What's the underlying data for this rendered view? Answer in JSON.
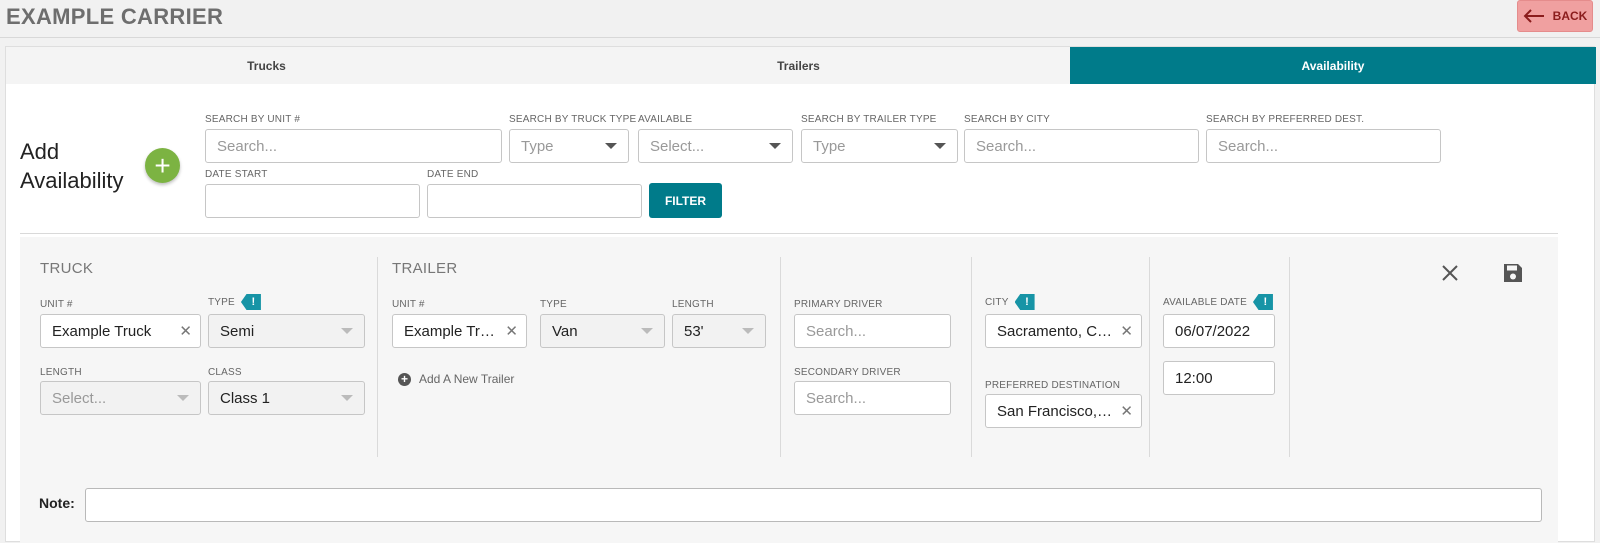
{
  "header": {
    "carrier_name": "EXAMPLE CARRIER",
    "back_label": "BACK"
  },
  "tabs": [
    {
      "label": "Trucks",
      "active": false
    },
    {
      "label": "Trailers",
      "active": false
    },
    {
      "label": "Availability",
      "active": true
    }
  ],
  "add_availability": {
    "label": "Add Availability",
    "button_symbol": "+"
  },
  "filters": {
    "unit": {
      "label": "SEARCH BY UNIT #",
      "placeholder": "Search..."
    },
    "truck_type": {
      "label": "SEARCH BY TRUCK TYPE",
      "placeholder": "Type"
    },
    "available": {
      "label": "AVAILABLE",
      "placeholder": "Select..."
    },
    "trailer_type": {
      "label": "SEARCH BY TRAILER TYPE",
      "placeholder": "Type"
    },
    "city": {
      "label": "SEARCH BY CITY",
      "placeholder": "Search..."
    },
    "preferred_dest": {
      "label": "SEARCH BY PREFERRED DEST.",
      "placeholder": "Search..."
    },
    "date_start": {
      "label": "DATE START",
      "value": ""
    },
    "date_end": {
      "label": "DATE END",
      "value": ""
    },
    "filter_button": "FILTER"
  },
  "card": {
    "truck": {
      "title": "TRUCK",
      "unit_label": "UNIT #",
      "unit_value": "Example Truck",
      "type_label": "TYPE",
      "type_value": "Semi",
      "length_label": "LENGTH",
      "length_placeholder": "Select...",
      "class_label": "CLASS",
      "class_value": "Class 1"
    },
    "trailer": {
      "title": "TRAILER",
      "unit_label": "UNIT #",
      "unit_value": "Example Trailer",
      "type_label": "TYPE",
      "type_value": "Van",
      "length_label": "LENGTH",
      "length_value": "53'",
      "add_new_label": "Add A New Trailer"
    },
    "drivers": {
      "primary_label": "PRIMARY DRIVER",
      "primary_placeholder": "Search...",
      "secondary_label": "SECONDARY DRIVER",
      "secondary_placeholder": "Search..."
    },
    "location": {
      "city_label": "CITY",
      "city_value": "Sacramento, CA ...",
      "pref_label": "PREFERRED DESTINATION",
      "pref_value": "San Francisco, C..."
    },
    "availability": {
      "date_label": "AVAILABLE DATE",
      "date_value": "06/07/2022",
      "time_value": "12:00"
    },
    "required_mark": "!",
    "note_label": "Note:"
  },
  "colors": {
    "accent": "#007b8a",
    "add_green": "#7cb342",
    "back_bg": "#f0a0a0",
    "badge": "#1794a6"
  },
  "icons": {
    "back": "arrow-left-icon",
    "add": "plus-circle-icon",
    "close": "close-icon",
    "save": "floppy-disk-icon",
    "clear": "clear-x-icon"
  }
}
